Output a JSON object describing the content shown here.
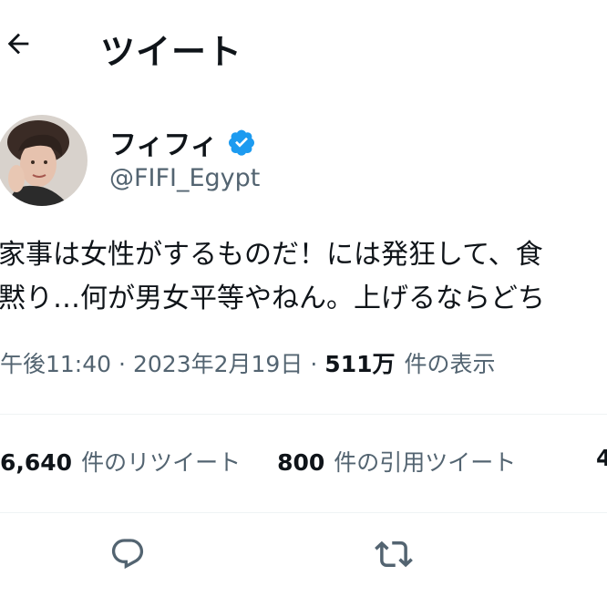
{
  "header": {
    "back_icon": "arrow-left-icon",
    "title": "ツイート"
  },
  "author": {
    "avatar_icon": "avatar",
    "display_name": "フィフィ",
    "verified_icon": "verified-badge-icon",
    "handle": "@FIFI_Egypt"
  },
  "tweet": {
    "lines": [
      "家事は女性がするものだ！には発狂して、食",
      "黙り…何が男女平等やねん。上げるならどち"
    ]
  },
  "meta": {
    "time": "午後11:40",
    "separator": "·",
    "date": "2023年2月19日",
    "views_count": "511万",
    "views_label": "件の表示"
  },
  "stats": {
    "retweets_count": "6,640",
    "retweets_label": "件のリツイート",
    "quotes_count": "800",
    "quotes_label": "件の引用ツイート",
    "likes_count_partial": "4"
  },
  "actions": {
    "reply_icon": "reply-icon",
    "retweet_icon": "retweet-icon"
  },
  "colors": {
    "text_primary": "#0f1419",
    "text_secondary": "#536471",
    "divider": "#eff3f4",
    "verified_blue": "#1d9bf0"
  }
}
